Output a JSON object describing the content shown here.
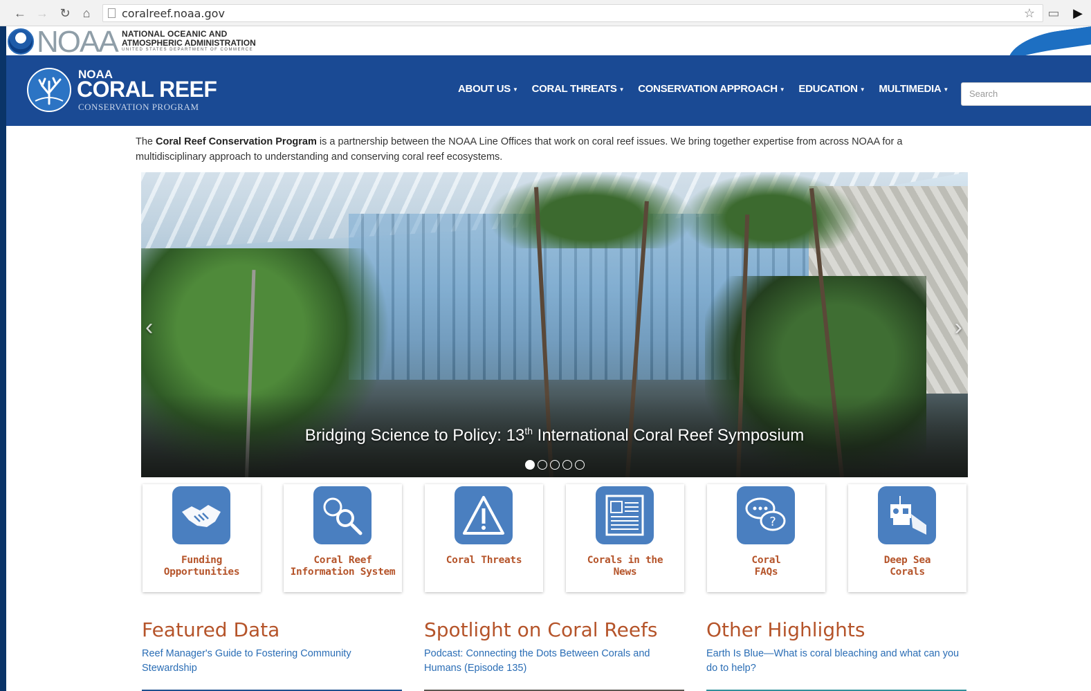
{
  "browser": {
    "url": "coralreef.noaa.gov"
  },
  "noaa_header": {
    "wordmark": "NOAA",
    "line1": "NATIONAL OCEANIC AND",
    "line2": "ATMOSPHERIC ADMINISTRATION",
    "line3": "UNITED STATES DEPARTMENT OF COMMERCE"
  },
  "site_logo": {
    "small": "NOAA",
    "title": "CORAL REEF",
    "subtitle": "CONSERVATION PROGRAM"
  },
  "nav": {
    "items": [
      {
        "label": "ABOUT US"
      },
      {
        "label": "CORAL THREATS"
      },
      {
        "label": "CONSERVATION APPROACH"
      },
      {
        "label": "EDUCATION"
      },
      {
        "label": "MULTIMEDIA"
      }
    ],
    "search_placeholder": "Search"
  },
  "intro": {
    "before": "The ",
    "bold": "Coral Reef Conservation Program",
    "after": " is a partnership between the NOAA Line Offices that work on coral reef issues. We bring together expertise from across NOAA for a multidisciplinary approach to understanding and conserving coral reef ecosystems."
  },
  "carousel": {
    "caption_pre": "Bridging Science to Policy: 13",
    "caption_sup": "th",
    "caption_post": " International Coral Reef Symposium",
    "slide_count": 5,
    "active_slide": 1
  },
  "cards": [
    {
      "line1": "Funding",
      "line2": "Opportunities",
      "icon": "handshake-icon"
    },
    {
      "line1": "Coral Reef",
      "line2": "Information System",
      "icon": "globe-magnifier-icon"
    },
    {
      "line1": "Coral Threats",
      "line2": "",
      "icon": "warning-triangle-icon"
    },
    {
      "line1": "Corals in the",
      "line2": "News",
      "icon": "newspaper-icon"
    },
    {
      "line1": "Coral",
      "line2": "FAQs",
      "icon": "speech-bubbles-icon"
    },
    {
      "line1": "Deep Sea",
      "line2": "Corals",
      "icon": "submersible-icon"
    }
  ],
  "columns": [
    {
      "heading": "Featured Data",
      "link": "Reef Manager's Guide to Fostering Community Stewardship"
    },
    {
      "heading": "Spotlight on Coral Reefs",
      "link": "Podcast: Connecting the Dots Between Corals and Humans (Episode 135)"
    },
    {
      "heading": "Other Highlights",
      "link": "Earth Is Blue—What is coral bleaching and what can you do to help?"
    }
  ],
  "colors": {
    "banner_blue": "#1a4a94",
    "heading_rust": "#b5542a",
    "link_blue": "#2a6db5",
    "icon_tile": "#4a7fc0"
  }
}
